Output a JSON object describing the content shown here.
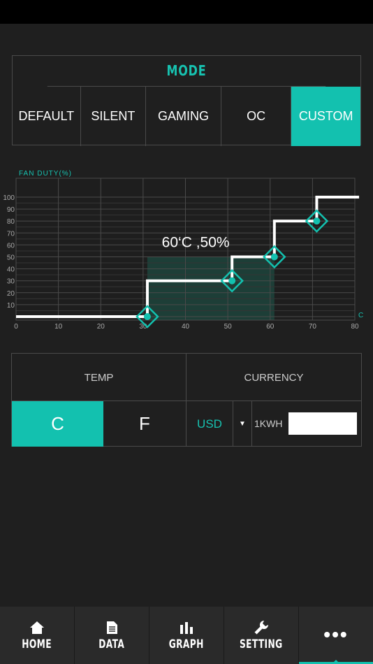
{
  "mode": {
    "title": "MODE",
    "options": [
      {
        "label": "DEFAULT"
      },
      {
        "label": "SILENT"
      },
      {
        "label": "GAMING"
      },
      {
        "label": "OC"
      },
      {
        "label": "CUSTOM"
      }
    ],
    "selected": "CUSTOM"
  },
  "chart_data": {
    "type": "line",
    "title": "",
    "ylabel": "FAN DUTY(%)",
    "xlabel": "C",
    "xlim": [
      0,
      80
    ],
    "ylim": [
      0,
      100
    ],
    "x_ticks": [
      0,
      10,
      20,
      30,
      40,
      50,
      60,
      70,
      80
    ],
    "y_ticks": [
      10,
      20,
      30,
      40,
      50,
      60,
      70,
      80,
      90,
      100
    ],
    "grid": true,
    "series": [
      {
        "values_step": [
          [
            0,
            0
          ],
          [
            31,
            0
          ],
          [
            31,
            30
          ],
          [
            51,
            30
          ],
          [
            51,
            50
          ],
          [
            61,
            50
          ],
          [
            61,
            80
          ],
          [
            71,
            80
          ],
          [
            71,
            100
          ],
          [
            81,
            100
          ]
        ]
      }
    ],
    "points": [
      {
        "x": 31,
        "y": 0
      },
      {
        "x": 51,
        "y": 30
      },
      {
        "x": 61,
        "y": 50
      },
      {
        "x": 71,
        "y": 80
      }
    ],
    "annotation": {
      "text": "60‘C ,50%",
      "x": 50,
      "y": 50
    },
    "highlight": {
      "x0": 31,
      "x1": 61,
      "y0": 0,
      "y1": 50
    },
    "colors": {
      "line": "#ffffff",
      "point": "#13c1af",
      "axis_label": "#17c2b0",
      "highlight": "#1d5a4c"
    }
  },
  "settings": {
    "temp": {
      "header": "TEMP",
      "options": [
        "C",
        "F"
      ],
      "selected": "C"
    },
    "currency": {
      "header": "CURRENCY",
      "value": "USD",
      "arrow": "▼",
      "kwh_label": "1KWH",
      "kwh_value": ""
    }
  },
  "nav": {
    "items": [
      {
        "label": "HOME",
        "icon": "home-icon"
      },
      {
        "label": "DATA",
        "icon": "data-icon"
      },
      {
        "label": "GRAPH",
        "icon": "graph-icon"
      },
      {
        "label": "SETTING",
        "icon": "wrench-icon"
      },
      {
        "label": "•••",
        "icon": "more-icon"
      }
    ],
    "active": "more"
  },
  "colors": {
    "accent": "#13c1af",
    "background": "#1f1f1f",
    "border": "#4a4a4a"
  }
}
